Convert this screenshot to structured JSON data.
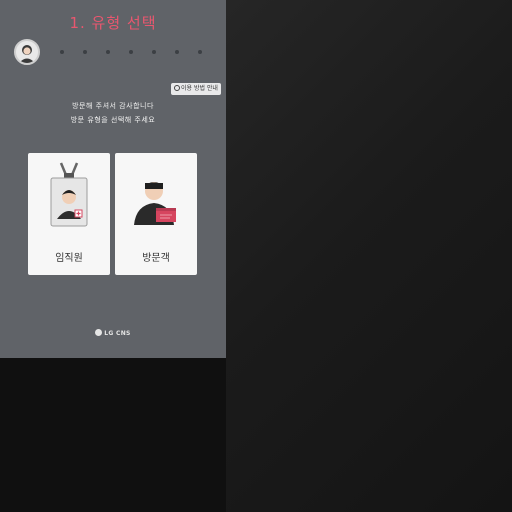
{
  "screen": {
    "title": "1. 유형 선택",
    "steps_total": 8,
    "help_button_label": "이용 방법 안내",
    "instruction_line1": "방문해 주셔서 감사합니다",
    "instruction_line2": "방문 유형을 선택해 주세요",
    "options": [
      {
        "label": "임직원",
        "icon": "employee-badge-icon"
      },
      {
        "label": "방문객",
        "icon": "visitor-icon"
      }
    ],
    "brand": "LG CNS"
  },
  "colors": {
    "panel": "#606368",
    "title": "#e8576f",
    "card": "#f7f7f7",
    "accent_red": "#d6455f"
  }
}
